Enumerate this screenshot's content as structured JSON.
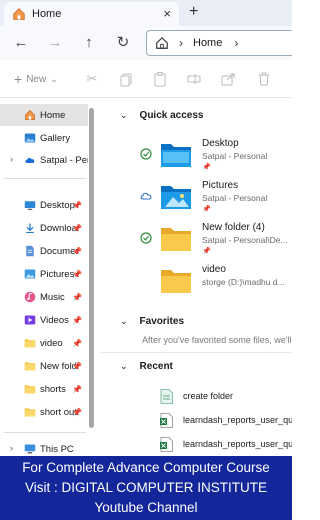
{
  "window": {
    "tab_title": "Home",
    "tab_close": "×",
    "new_tab": "+"
  },
  "address": {
    "crumb": "Home",
    "separator": "›"
  },
  "nav": {
    "back": "←",
    "forward": "→",
    "up": "↑",
    "refresh": "↻"
  },
  "command_bar": {
    "new_label": "New",
    "new_plus": "+",
    "new_caret": "⌄"
  },
  "sidebar": {
    "home": "Home",
    "gallery": "Gallery",
    "onedrive": "Satpal - Pers",
    "items": [
      {
        "label": "Desktop",
        "icon": "desktop-icon"
      },
      {
        "label": "Downloa",
        "icon": "download-icon"
      },
      {
        "label": "Documer",
        "icon": "document-icon"
      },
      {
        "label": "Pictures",
        "icon": "pictures-icon"
      },
      {
        "label": "Music",
        "icon": "music-icon"
      },
      {
        "label": "Videos",
        "icon": "videos-icon"
      },
      {
        "label": "video",
        "icon": "folder-icon"
      },
      {
        "label": "New fold",
        "icon": "folder-icon"
      },
      {
        "label": "shorts",
        "icon": "folder-icon"
      },
      {
        "label": "short out",
        "icon": "folder-icon"
      }
    ],
    "this_pc": "This PC"
  },
  "quick_access": {
    "title": "Quick access",
    "items": [
      {
        "name": "Desktop",
        "sub": "Satpal - Personal",
        "status": "synced"
      },
      {
        "name": "Pictures",
        "sub": "Satpal - Personal",
        "status": "cloud"
      },
      {
        "name": "New folder (4)",
        "sub": "Satpal - Personal\\De...",
        "status": "synced"
      },
      {
        "name": "video",
        "sub": "storge (D:)\\madhu d...",
        "status": "none"
      }
    ]
  },
  "favorites": {
    "title": "Favorites",
    "hint": "After you've favorited some files, we'll s"
  },
  "recent": {
    "title": "Recent",
    "items": [
      {
        "name": "create folder",
        "type": "doc"
      },
      {
        "name": "learndash_reports_user_quiz",
        "type": "excel"
      },
      {
        "name": "learndash_reports_user_quiz",
        "type": "excel"
      }
    ]
  },
  "banner": {
    "line1": "For Complete Advance Computer Course",
    "line2": "Visit : DIGITAL COMPUTER INSTITUTE",
    "line3": "Youtube Channel"
  },
  "colors": {
    "banner_bg": "#14279a",
    "folder_yellow": "#f8c94a",
    "folder_blue": "#1e88d7",
    "sync_green": "#2e8b3a"
  }
}
